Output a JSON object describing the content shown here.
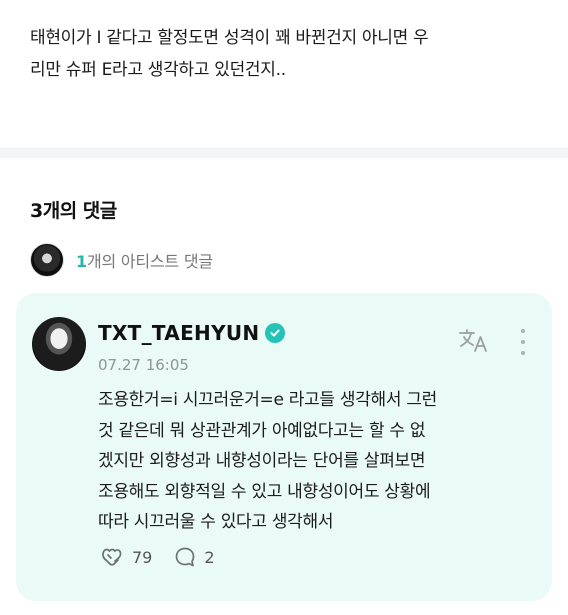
{
  "post": {
    "text_line1": "태현이가 I 같다고 할정도면 성격이 꽤 바뀐건지 아니면 우",
    "text_line2": "리만 슈퍼 E라고 생각하고 있던건지.."
  },
  "comments": {
    "count_label": "3개의 댓글",
    "artist_count_num": "1",
    "artist_count_suffix": "개의 아티스트 댓글"
  },
  "artist_comment": {
    "author": "TXT_TAEHYUN",
    "date": "07.27 16:05",
    "lines": [
      "조용한거=i 시끄러운거=e 라고들 생각해서 그런",
      "것 같은데 뭐 상관관계가 아예없다고는 할 수 없",
      "겠지만 외향성과 내향성이라는 단어를 살펴보면",
      "조용해도 외향적일 수 있고 내향성이어도 상황에",
      "따라 시끄러울 수 있다고 생각해서"
    ],
    "likes": "79",
    "replies": "2"
  },
  "icons": {
    "translate": "translate-icon",
    "more": "more-vertical-icon",
    "like": "heart-hands-icon",
    "reply": "speech-bubble-icon",
    "verified": "verified-badge-icon"
  },
  "colors": {
    "accent": "#27b3b0",
    "card_bg": "#e9faf7",
    "verified": "#25c3b7"
  }
}
